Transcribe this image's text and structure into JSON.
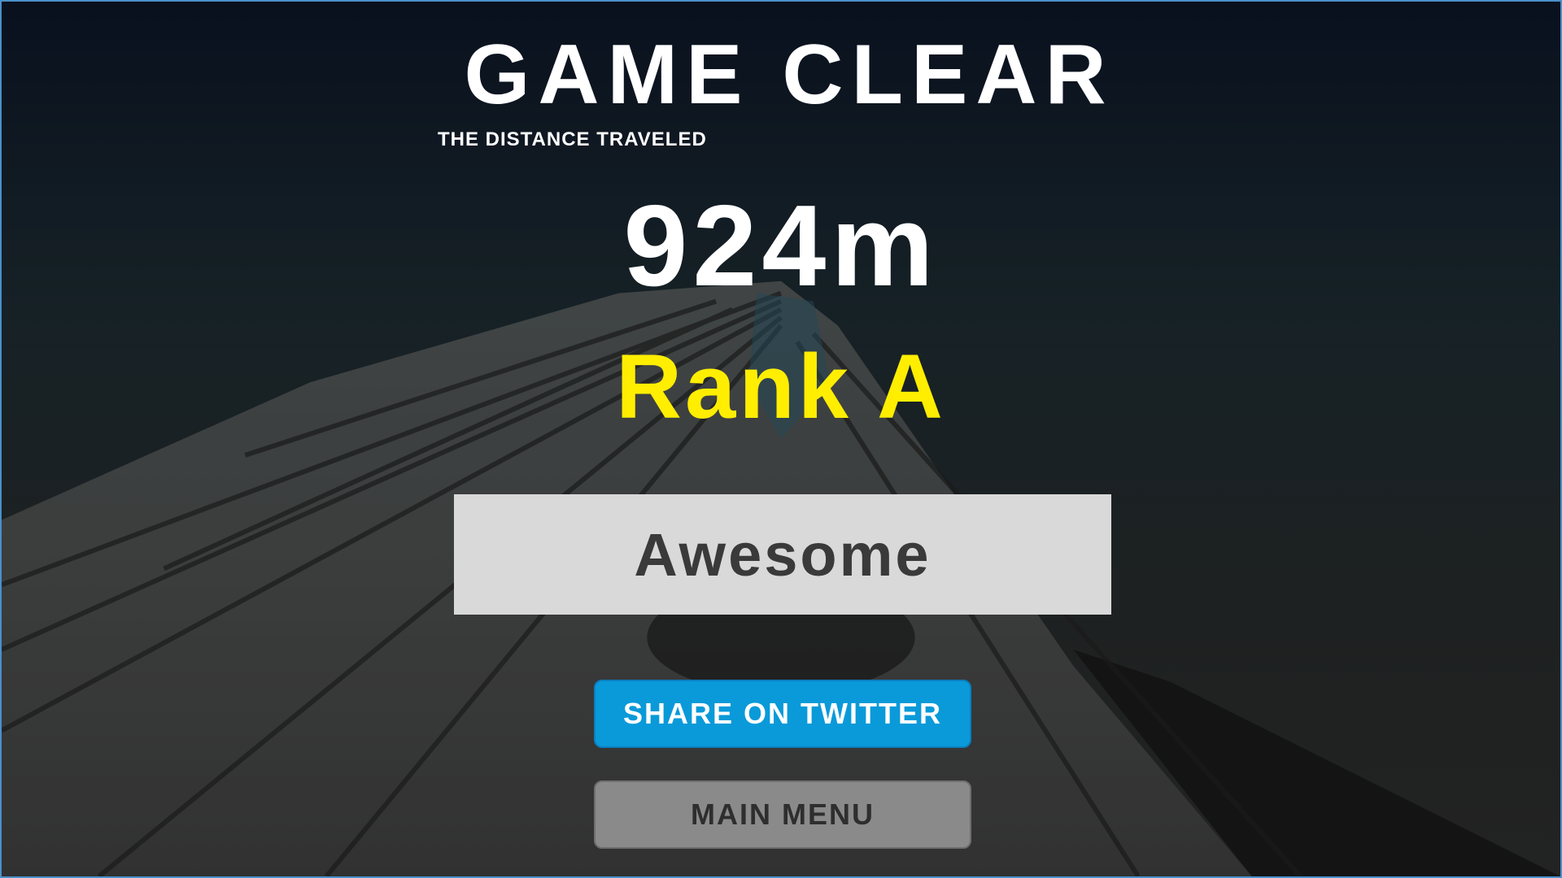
{
  "result": {
    "title": "GAME CLEAR",
    "subtitle": "THE DISTANCE TRAVELED",
    "distance": "924m",
    "rank": "Rank A",
    "comment": "Awesome"
  },
  "buttons": {
    "share_label": "SHARE ON TWITTER",
    "menu_label": "MAIN MENU"
  },
  "colors": {
    "rank_text": "#ffee00",
    "title_text": "#ffffff",
    "comment_bg": "#d9d9d9",
    "comment_text": "#3a3a3a",
    "share_bg": "#0a9ad9",
    "share_text": "#ffffff",
    "menu_bg": "#8a8a8a",
    "menu_text": "#2e2e2e"
  }
}
